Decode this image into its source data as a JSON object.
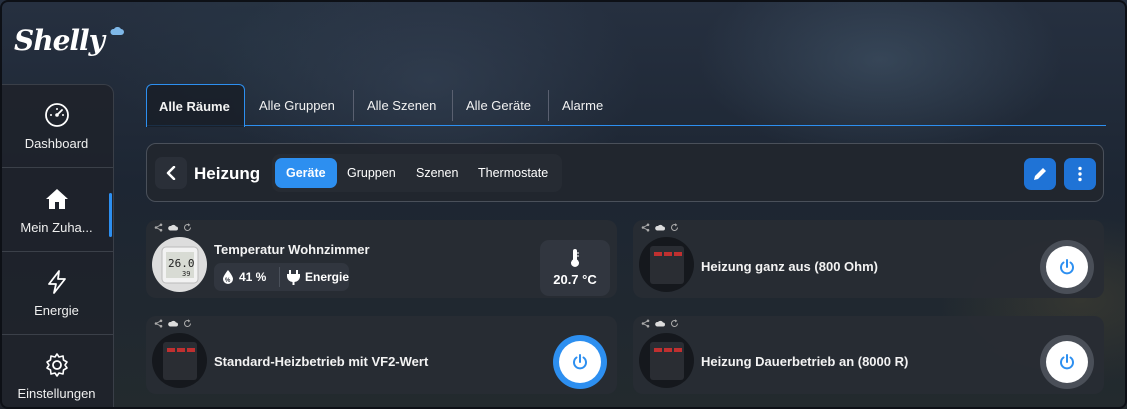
{
  "app": {
    "brand": "Shelly"
  },
  "sidebar": {
    "items": [
      {
        "label": "Dashboard",
        "icon": "gauge-icon"
      },
      {
        "label": "Mein Zuha...",
        "icon": "home-icon",
        "active": true
      },
      {
        "label": "Energie",
        "icon": "lightning-icon"
      },
      {
        "label": "Einstellungen",
        "icon": "gear-icon"
      }
    ]
  },
  "tabs": [
    {
      "label": "Alle Räume",
      "active": true
    },
    {
      "label": "Alle Gruppen"
    },
    {
      "label": "Alle Szenen"
    },
    {
      "label": "Alle Geräte"
    },
    {
      "label": "Alarme"
    }
  ],
  "room": {
    "title": "Heizung",
    "subtabs": [
      {
        "label": "Geräte",
        "active": true
      },
      {
        "label": "Gruppen"
      },
      {
        "label": "Szenen"
      },
      {
        "label": "Thermostate"
      }
    ]
  },
  "devices": [
    {
      "name": "Temperatur Wohnzimmer",
      "humidity": "41 %",
      "power_label": "Energie",
      "temperature": "20.7 °C",
      "sensor_display_top": "26.0",
      "sensor_display_bottom": "39"
    },
    {
      "name": "Heizung ganz aus (800 Ohm)",
      "state": "off"
    },
    {
      "name": "Standard-Heizbetrieb mit VF2-Wert",
      "state": "on"
    },
    {
      "name": "Heizung Dauerbetrieb an (8000 R)",
      "state": "off"
    }
  ],
  "colors": {
    "accent": "#2d8ff0",
    "card": "#282c34",
    "background": "#1c2430"
  }
}
